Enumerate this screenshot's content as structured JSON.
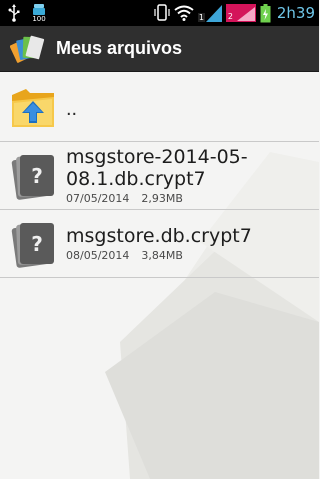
{
  "status_bar": {
    "icons": [
      "usb-icon",
      "storage-icon",
      "phone-vibrate-icon",
      "wifi-icon",
      "signal-sim1-icon",
      "signal-sim2-icon",
      "battery-icon"
    ],
    "storage_label": "100",
    "sim1_label": "1",
    "sim2_label": "2",
    "time": "2h39",
    "time_color": "#6fc6e8",
    "sim2_color": "#d4145a"
  },
  "action_bar": {
    "title": "Meus arquivos",
    "background": "#2f2f2f"
  },
  "files": {
    "parent": {
      "label": "..",
      "icon": "folder-up-icon"
    },
    "items": [
      {
        "name": "msgstore-2014-05-08.1.db.crypt7",
        "date": "07/05/2014",
        "size": "2,93MB",
        "icon": "unknown-file-icon"
      },
      {
        "name": "msgstore.db.crypt7",
        "date": "08/05/2014",
        "size": "3,84MB",
        "icon": "unknown-file-icon"
      }
    ]
  }
}
